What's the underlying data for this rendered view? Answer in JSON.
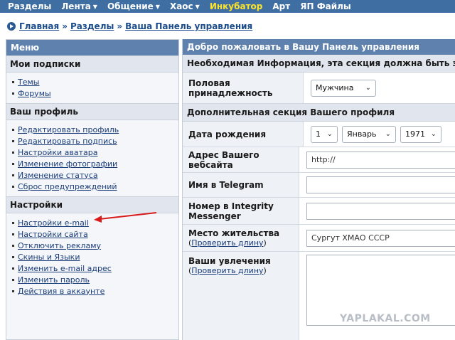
{
  "nav": {
    "items": [
      {
        "label": "Разделы",
        "caret": false,
        "highlight": false
      },
      {
        "label": "Лента",
        "caret": true,
        "highlight": false
      },
      {
        "label": "Общение",
        "caret": true,
        "highlight": false
      },
      {
        "label": "Хаос",
        "caret": true,
        "highlight": false
      },
      {
        "label": "Инкубатор",
        "caret": false,
        "highlight": true
      },
      {
        "label": "Арт",
        "caret": false,
        "highlight": false
      },
      {
        "label": "ЯП Файлы",
        "caret": false,
        "highlight": false
      }
    ],
    "colors": {
      "bar": "#3f6ea3",
      "highlight": "#fde42a"
    }
  },
  "breadcrumb": {
    "home": "Главная",
    "sections": "Разделы",
    "current": "Ваша Панель управления",
    "separator": "»"
  },
  "sidebar": {
    "header": "Меню",
    "sections": [
      {
        "title": "Мои подписки",
        "items": [
          "Темы",
          "Форумы"
        ]
      },
      {
        "title": "Ваш профиль",
        "items": [
          "Редактировать профиль",
          "Редактировать подпись",
          "Настройки аватара",
          "Изменение фотографии",
          "Изменение статуса",
          "Сброс предупреждений"
        ]
      },
      {
        "title": "Настройки",
        "items": [
          "Настройки e-mail",
          "Настройки сайта",
          "Отключить рекламу",
          "Скины и Языки",
          "Изменить e-mail адрес",
          "Изменить пароль",
          "Действия в аккаунте"
        ]
      }
    ]
  },
  "main": {
    "header": "Добро пожаловать в Вашу Панель управления",
    "required_info": "Необходимая Информация, эта секция должна быть заполне",
    "gender": {
      "label_line1": "Половая",
      "label_line2": "принадлежность",
      "value": "Мужчина"
    },
    "additional": "Дополнительная секция Вашего профиля",
    "birthdate": {
      "label": "Дата рождения",
      "day": "1",
      "month": "Январь",
      "year": "1971"
    },
    "website": {
      "label": "Адрес Вашего вебсайта",
      "value": "http://"
    },
    "telegram": {
      "label": "Имя в Telegram",
      "value": ""
    },
    "integrity": {
      "label_line1": "Номер в Integrity",
      "label_line2": "Messenger",
      "value": ""
    },
    "location": {
      "label": "Место жительства",
      "check_prefix": "(",
      "check_link": "Проверить длину",
      "check_suffix": ")",
      "value": "Сургут ХМАО СССР"
    },
    "interests": {
      "label": "Ваши увлечения",
      "check_prefix": "(",
      "check_link": "Проверить длину",
      "check_suffix": ")"
    }
  },
  "watermark": "YAPLAKAL.COM"
}
